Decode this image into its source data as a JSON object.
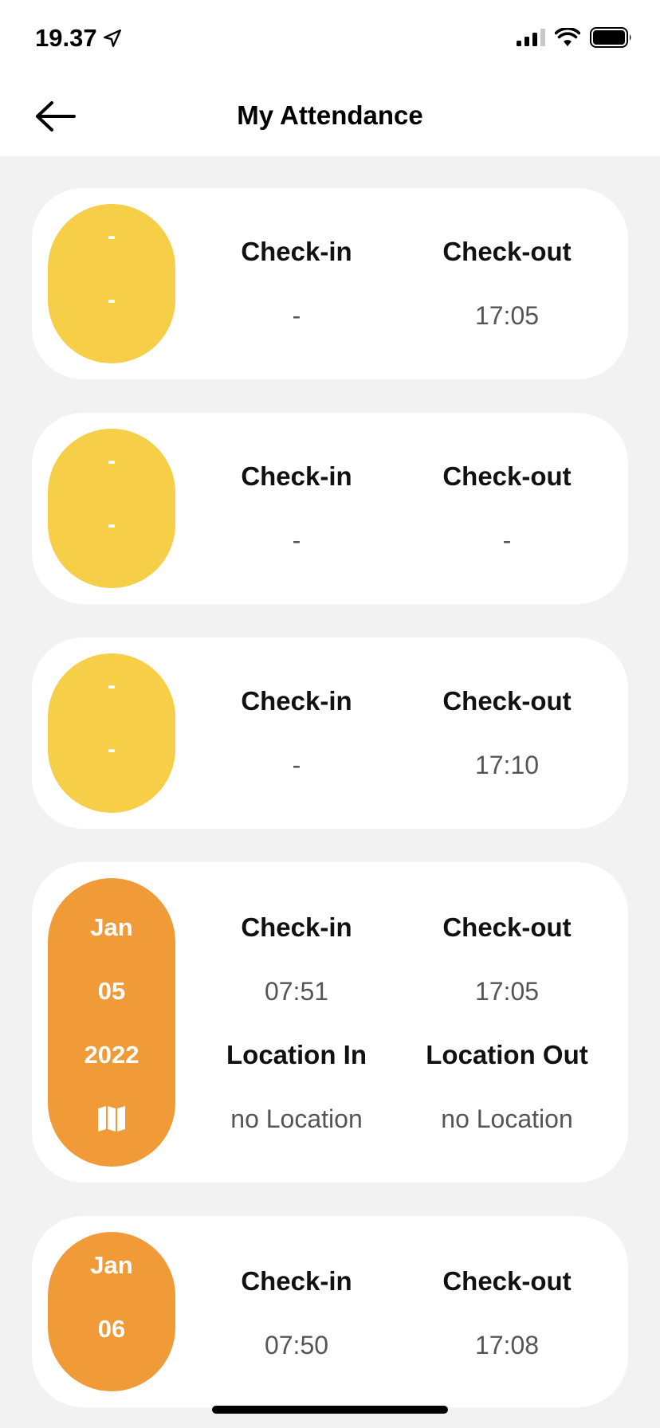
{
  "status_bar": {
    "time": "19.37"
  },
  "header": {
    "title": "My Attendance"
  },
  "records": [
    {
      "date_lines": [
        "-",
        "-"
      ],
      "status": "incomplete",
      "checkin_label": "Check-in",
      "checkin": "-",
      "checkout_label": "Check-out",
      "checkout": "17:05"
    },
    {
      "date_lines": [
        "-",
        "-"
      ],
      "status": "incomplete",
      "checkin_label": "Check-in",
      "checkin": "-",
      "checkout_label": "Check-out",
      "checkout": "-"
    },
    {
      "date_lines": [
        "-",
        "-"
      ],
      "status": "incomplete",
      "checkin_label": "Check-in",
      "checkin": "-",
      "checkout_label": "Check-out",
      "checkout": "17:10"
    },
    {
      "date_lines": [
        "Jan",
        "05",
        "2022"
      ],
      "status": "complete",
      "map_icon": "map-icon",
      "checkin_label": "Check-in",
      "checkin": "07:51",
      "checkout_label": "Check-out",
      "checkout": "17:05",
      "location_in_label": "Location In",
      "location_in": "no Location",
      "location_out_label": "Location Out",
      "location_out": "no Location"
    },
    {
      "date_lines": [
        "Jan",
        "06"
      ],
      "status": "complete",
      "checkin_label": "Check-in",
      "checkin": "07:50",
      "checkout_label": "Check-out",
      "checkout": "17:08"
    }
  ],
  "colors": {
    "pill_incomplete": "#f7ce47",
    "pill_complete": "#f09b38",
    "background": "#f2f2f2"
  }
}
